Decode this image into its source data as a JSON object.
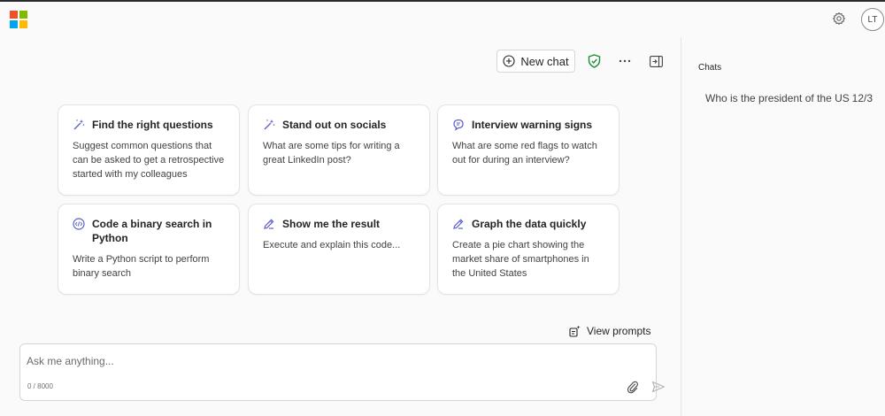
{
  "colors": {
    "logo_red": "#f25022",
    "logo_green": "#7fba00",
    "logo_blue": "#00a4ef",
    "logo_yellow": "#ffb900",
    "accent": "#5b5fc7",
    "shield_green": "#1e8e3e"
  },
  "header": {
    "avatar_initials": "LT"
  },
  "toolbar": {
    "new_chat_label": "New chat"
  },
  "cards": [
    {
      "icon": "sparkle-pen-icon",
      "title": "Find the right questions",
      "description": "Suggest common questions that can be asked to get a retrospective started with my colleagues"
    },
    {
      "icon": "sparkle-pen-icon",
      "title": "Stand out on socials",
      "description": "What are some tips for writing a great LinkedIn post?"
    },
    {
      "icon": "chat-bubbles-icon",
      "title": "Interview warning signs",
      "description": "What are some red flags to watch out for during an interview?"
    },
    {
      "icon": "code-circle-icon",
      "title": "Code a binary search in Python",
      "description": "Write a Python script to perform binary search"
    },
    {
      "icon": "pen-icon",
      "title": "Show me the result",
      "description": "Execute and explain this code..."
    },
    {
      "icon": "pen-icon",
      "title": "Graph the data quickly",
      "description": "Create a pie chart showing the market share of smartphones in the United States"
    }
  ],
  "view_prompts_label": "View prompts",
  "composer": {
    "placeholder": "Ask me anything...",
    "char_count": "0 / 8000"
  },
  "sidebar": {
    "title": "Chats",
    "chats": [
      {
        "title": "Who is the president of the US",
        "date": "12/3"
      }
    ]
  }
}
